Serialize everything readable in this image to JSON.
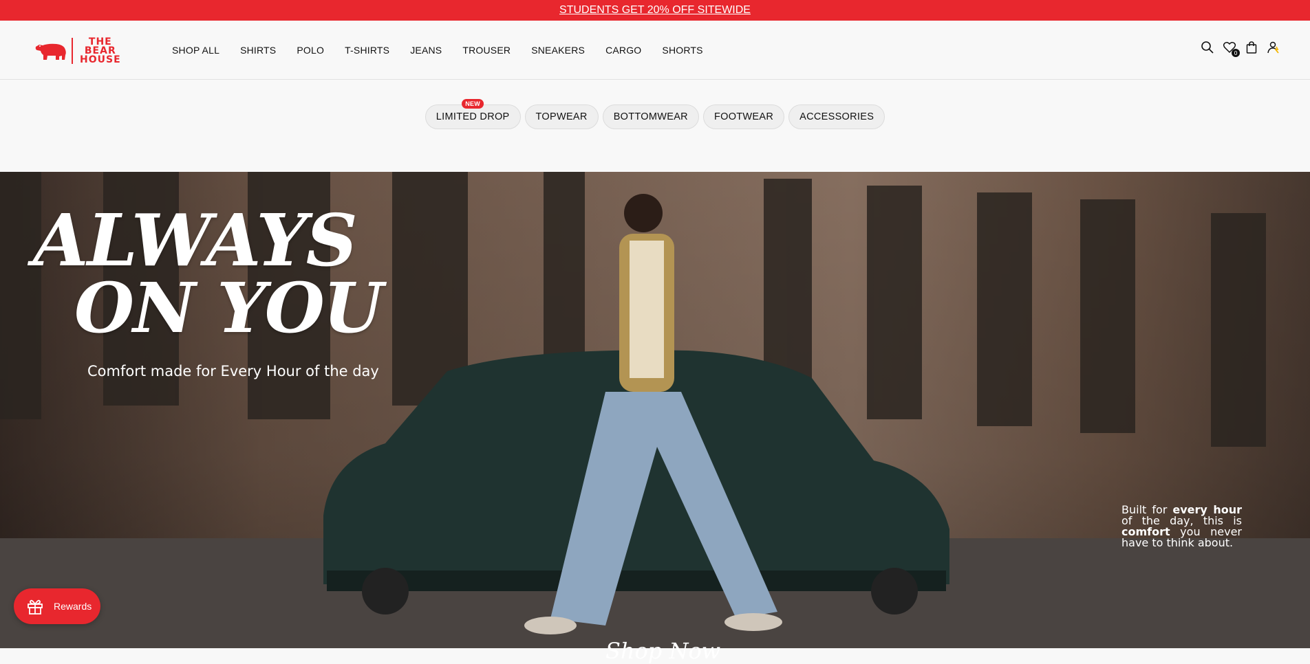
{
  "announcement": {
    "text": "STUDENTS GET 20% OFF SITEWIDE"
  },
  "brand": {
    "line1": "THE",
    "line2": "BEAR",
    "line3": "HOUSE",
    "color": "#e8272e"
  },
  "nav": {
    "items": [
      "SHOP ALL",
      "SHIRTS",
      "POLO",
      "T-SHIRTS",
      "JEANS",
      "TROUSER",
      "SNEAKERS",
      "CARGO",
      "SHORTS"
    ]
  },
  "header_icons": {
    "search": "search-icon",
    "wishlist": "heart-icon",
    "wishlist_count": "0",
    "cart": "shopping-bag-icon",
    "account": "user-icon"
  },
  "categories": [
    {
      "label": "LIMITED DROP",
      "badge": "NEW"
    },
    {
      "label": "TOPWEAR"
    },
    {
      "label": "BOTTOMWEAR"
    },
    {
      "label": "FOOTWEAR"
    },
    {
      "label": "ACCESSORIES"
    }
  ],
  "hero": {
    "headline_line1": "ALWAYS",
    "headline_line2": "ON YOU",
    "tagline": "Comfort made for Every Hour of the day",
    "side_note": {
      "part1": "Built for ",
      "bold1": "every hour",
      "part2": " of the day, this is ",
      "bold2": "comfort",
      "part3": " you never have to think about."
    },
    "cta": "Shop Now"
  },
  "rewards": {
    "label": "Rewards"
  }
}
